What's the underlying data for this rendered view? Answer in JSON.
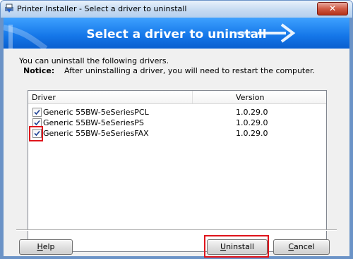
{
  "window": {
    "title": "Printer Installer - Select a driver to uninstall",
    "close_glyph": "✕"
  },
  "banner": {
    "heading": "Select a driver to uninstall",
    "color_top": "#3ea1ff",
    "color_bottom": "#0a5fcf"
  },
  "intro": {
    "text": "You can uninstall the following drivers.",
    "notice_label": "Notice:",
    "notice_text": "After uninstalling a driver, you will need to restart the computer."
  },
  "list": {
    "headers": {
      "driver": "Driver",
      "version": "Version"
    },
    "rows": [
      {
        "name": "Generic 55BW-5eSeriesPCL",
        "version": "1.0.29.0",
        "checked": true
      },
      {
        "name": "Generic 55BW-5eSeriesPS",
        "version": "1.0.29.0",
        "checked": true
      },
      {
        "name": "Generic 55BW-5eSeriesFAX",
        "version": "1.0.29.0",
        "checked": true
      }
    ]
  },
  "buttons": {
    "help": {
      "mnemonic": "H",
      "rest": "elp"
    },
    "uninstall": {
      "mnemonic": "U",
      "rest": "ninstall"
    },
    "cancel": {
      "mnemonic": "C",
      "rest": "ancel"
    }
  },
  "highlight_color": "#e0141b"
}
